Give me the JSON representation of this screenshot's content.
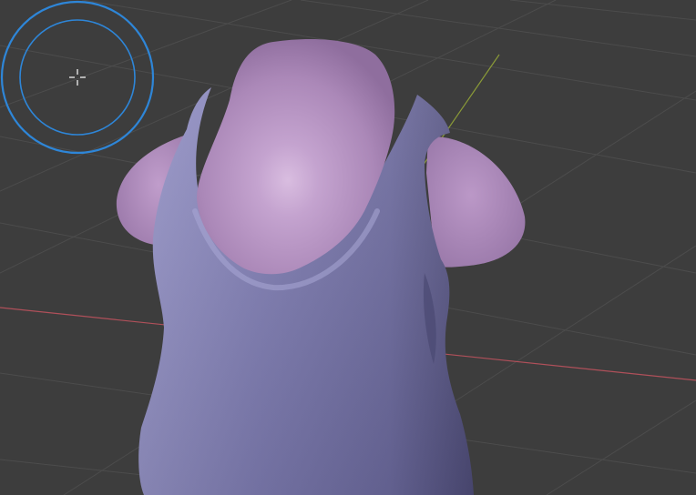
{
  "viewport": {
    "mode": "sculpt",
    "background_color": "#3d3d3d",
    "grid_color": "#4c4c4c",
    "x_axis_color": "#b0505a",
    "y_axis_color": "#8a9a38"
  },
  "model": {
    "icon": "sculpt-mesh",
    "skin_color": "#b18dbd",
    "shirt_color": "#7d7bb1"
  },
  "brush_cursor": {
    "icon": "brush-radius-circle",
    "color": "#2e86d8"
  },
  "origin_cursor": {
    "icon": "crosshair-icon"
  }
}
